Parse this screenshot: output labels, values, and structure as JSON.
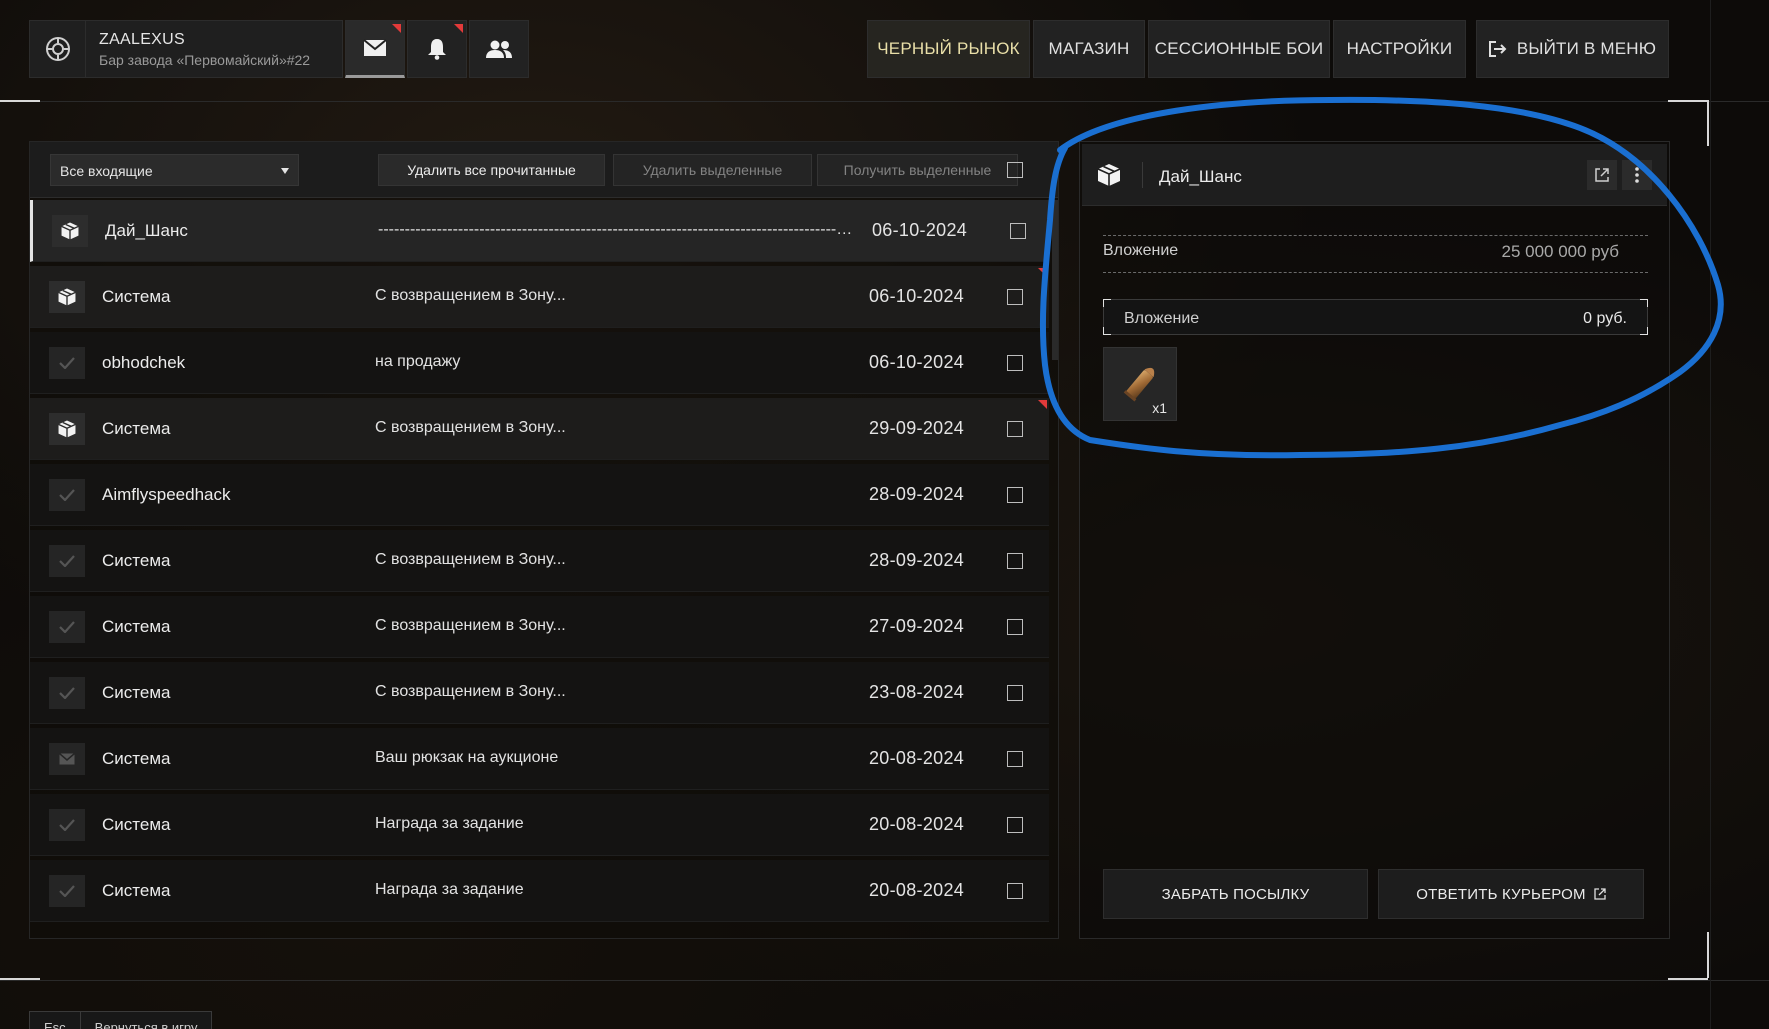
{
  "profile": {
    "username": "ZAALEXUS",
    "location": "Бар завода «Первомайский»#22"
  },
  "topnav": {
    "mail_icon": "envelope-icon",
    "notifications_icon": "bell-icon",
    "friends_icon": "users-icon",
    "black_market": "ЧЕРНЫЙ РЫНОК",
    "shop": "МАГАЗИН",
    "session_battles": "СЕССИОННЫЕ БОИ",
    "settings": "НАСТРОЙКИ",
    "exit_to_menu": "ВЫЙТИ В МЕНЮ"
  },
  "toolbar": {
    "filter_selected": "Все входящие",
    "delete_all_read": "Удалить все прочитанные",
    "delete_selected": "Удалить выделенные",
    "receive_selected": "Получить выделенные"
  },
  "messages": [
    {
      "sender": "Дай_Шанс",
      "subject": "------------------------------------------------------------------------------------------------------------------------",
      "date": "06-10-2024",
      "icon": "package-icon",
      "state": "selected",
      "flag": false
    },
    {
      "sender": "Система",
      "subject": "С возвращением в Зону...",
      "date": "06-10-2024",
      "icon": "package-icon",
      "state": "unread",
      "flag": true
    },
    {
      "sender": "obhodchek",
      "subject": "на продажу",
      "date": "06-10-2024",
      "icon": "check-icon",
      "state": "read",
      "flag": false
    },
    {
      "sender": "Система",
      "subject": "С возвращением в Зону...",
      "date": "29-09-2024",
      "icon": "package-icon",
      "state": "unread",
      "flag": true
    },
    {
      "sender": "Aimflyspeedhack",
      "subject": "",
      "date": "28-09-2024",
      "icon": "check-icon",
      "state": "read",
      "flag": false
    },
    {
      "sender": "Система",
      "subject": "С возвращением в Зону...",
      "date": "28-09-2024",
      "icon": "check-icon",
      "state": "read",
      "flag": false
    },
    {
      "sender": "Система",
      "subject": "С возвращением в Зону...",
      "date": "27-09-2024",
      "icon": "check-icon",
      "state": "read",
      "flag": false
    },
    {
      "sender": "Система",
      "subject": "С возвращением в Зону...",
      "date": "23-08-2024",
      "icon": "check-icon",
      "state": "read",
      "flag": false
    },
    {
      "sender": "Система",
      "subject": "Ваш рюкзак на аукционе",
      "date": "20-08-2024",
      "icon": "envelope-icon",
      "state": "read",
      "flag": false
    },
    {
      "sender": "Система",
      "subject": "Награда за задание",
      "date": "20-08-2024",
      "icon": "check-icon",
      "state": "read",
      "flag": false
    },
    {
      "sender": "Система",
      "subject": "Награда за задание",
      "date": "20-08-2024",
      "icon": "check-icon",
      "state": "read",
      "flag": false
    }
  ],
  "detail": {
    "sender": "Дай_Шанс",
    "attachment_label": "Вложение",
    "attachment_sum": "25 000 000 руб",
    "attachment_box_label": "Вложение",
    "attachment_box_value": "0 руб.",
    "item_icon": "bullet-icon",
    "item_qty": "x1",
    "take_parcel": "ЗАБРАТЬ ПОСЫЛКУ",
    "reply_courier": "ОТВЕТИТЬ КУРЬЕРОМ"
  },
  "bottom": {
    "key": "Esc",
    "label": "Вернуться в игру"
  },
  "colors": {
    "accent_red": "#e23a3a",
    "annotation_blue": "#1a6fd1",
    "highlight_text": "#e9dfa8"
  }
}
